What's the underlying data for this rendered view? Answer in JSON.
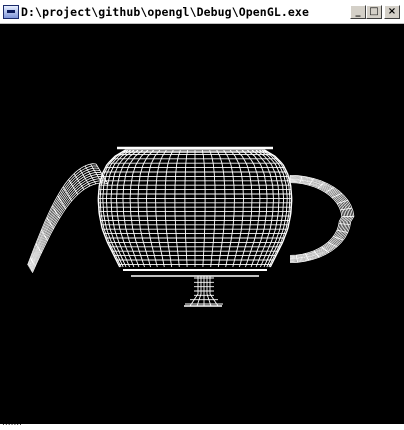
{
  "window": {
    "title": "D:\\project\\github\\opengl\\Debug\\OpenGL.exe",
    "icon": "console-app-icon",
    "controls": {
      "minimize": "_",
      "maximize": "□",
      "close": "×"
    }
  },
  "viewport": {
    "background": "#000000",
    "wire_color": "#ffffff",
    "content": "wireframe-teapot"
  },
  "taskbar": {
    "text": "......."
  }
}
